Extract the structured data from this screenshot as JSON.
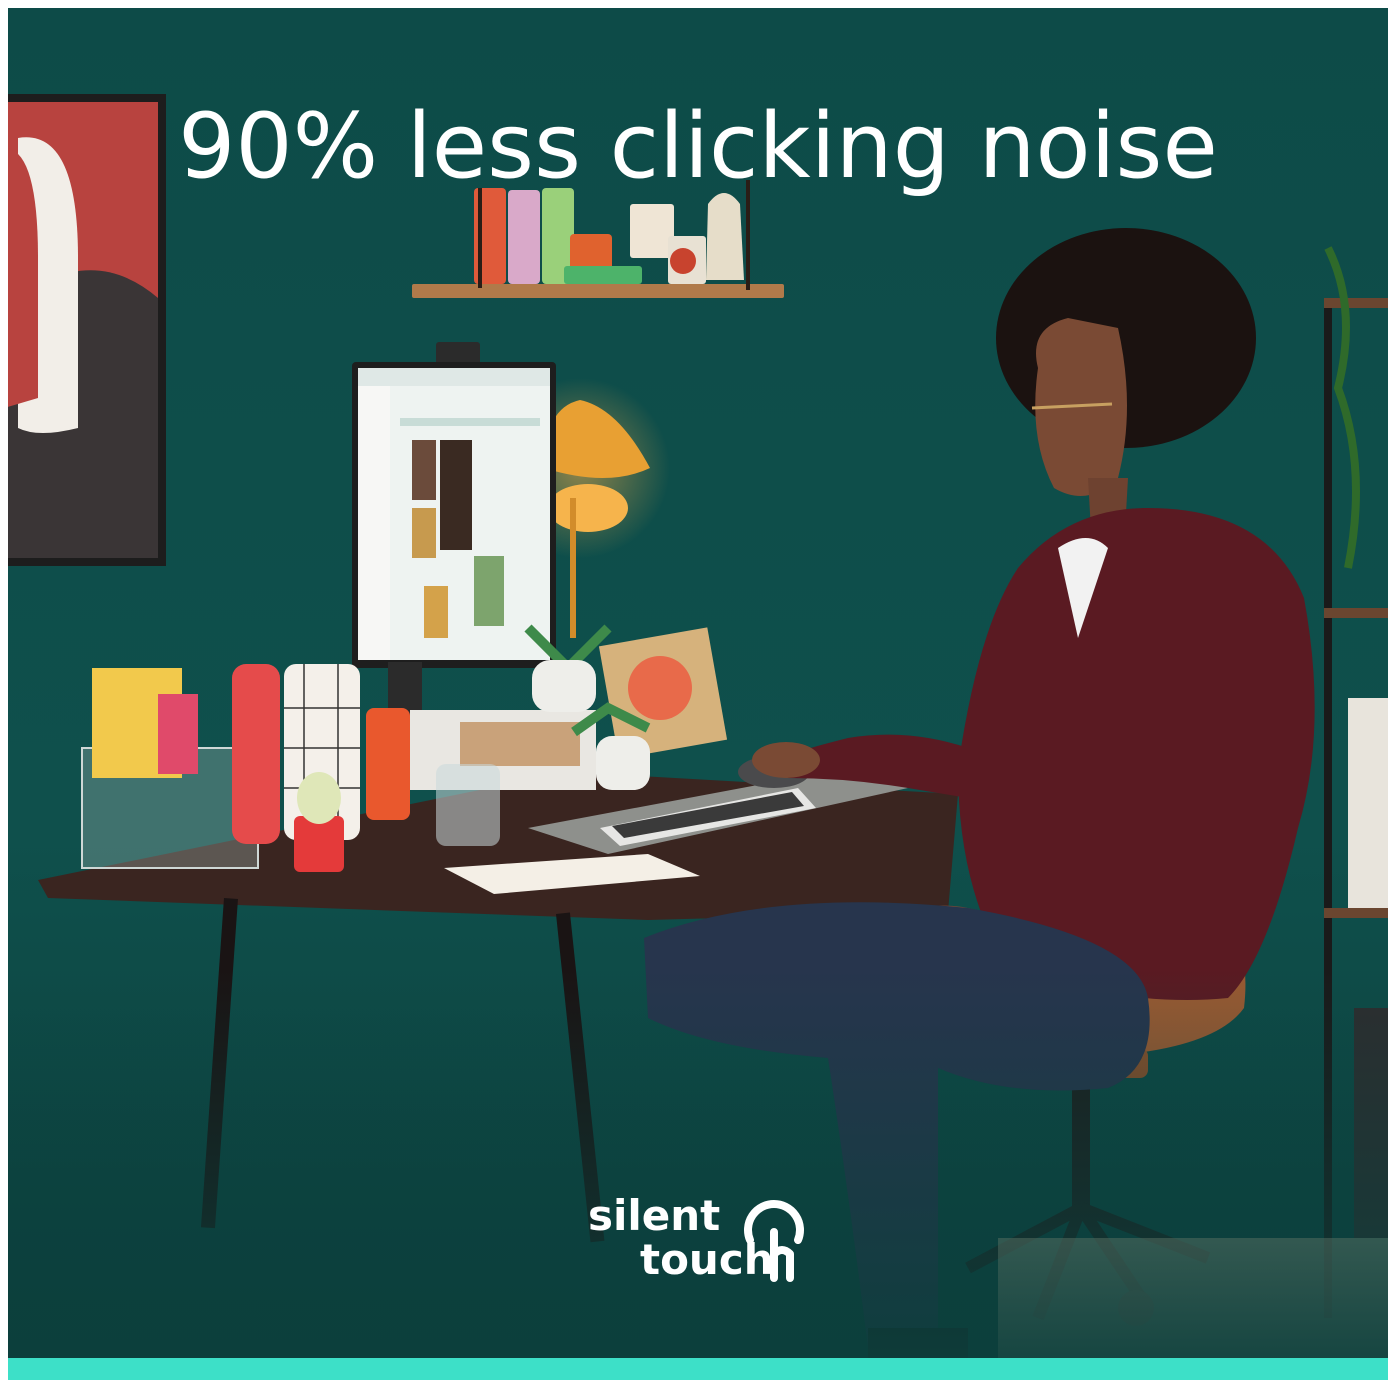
{
  "headline": "90% less clicking noise",
  "brand": {
    "line1": "silent",
    "line2": "touch",
    "icon": "finger-press-icon"
  },
  "colors": {
    "wall": "#0f4d49",
    "accent_bar": "#3de0c8",
    "text": "#ffffff",
    "shirt": "#5a1a22",
    "desk": "#3a2520"
  }
}
